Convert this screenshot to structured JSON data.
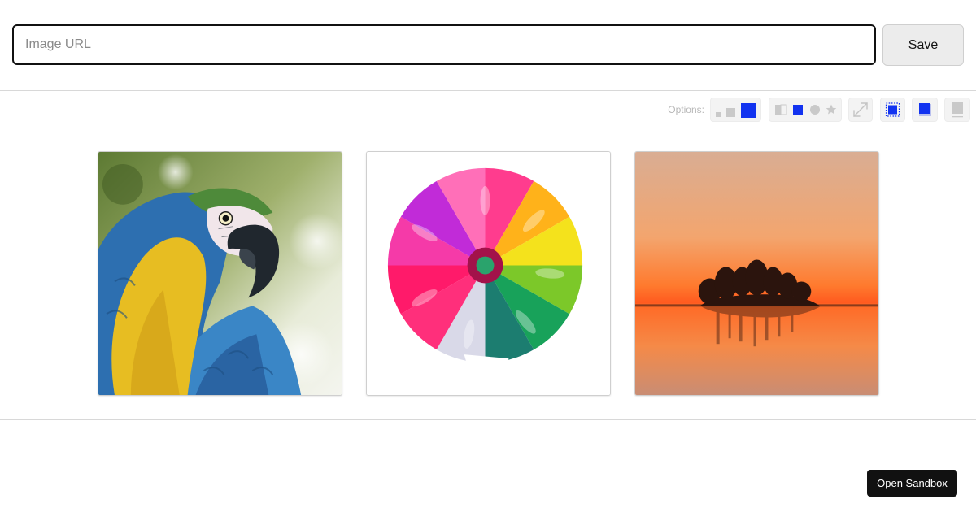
{
  "url_bar": {
    "placeholder": "Image URL",
    "value": "",
    "save_label": "Save"
  },
  "options": {
    "label": "Options:",
    "accent_color": "#1233f0",
    "inactive_color": "#c9c9c9",
    "groups": [
      {
        "name": "size",
        "choices": [
          "small",
          "medium",
          "large"
        ],
        "selected": "large"
      },
      {
        "name": "shape",
        "choices": [
          "split-square",
          "square",
          "circle",
          "star"
        ],
        "selected": "square"
      },
      {
        "name": "expand",
        "icon": "expand-arrows-icon",
        "active": false
      },
      {
        "name": "border-dotted",
        "icon": "dotted-square-icon",
        "active": true
      },
      {
        "name": "shadow",
        "icon": "shadow-square-icon",
        "active": true
      },
      {
        "name": "caption",
        "icon": "gray-square-caption-icon",
        "active": false
      }
    ]
  },
  "gallery": {
    "images": [
      {
        "subject": "blue-and-yellow macaw parrot"
      },
      {
        "subject": "rainbow chrysanthemum flower"
      },
      {
        "subject": "sunset over lake with tree island"
      }
    ]
  },
  "footer": {
    "sandbox_label": "Open Sandbox"
  }
}
